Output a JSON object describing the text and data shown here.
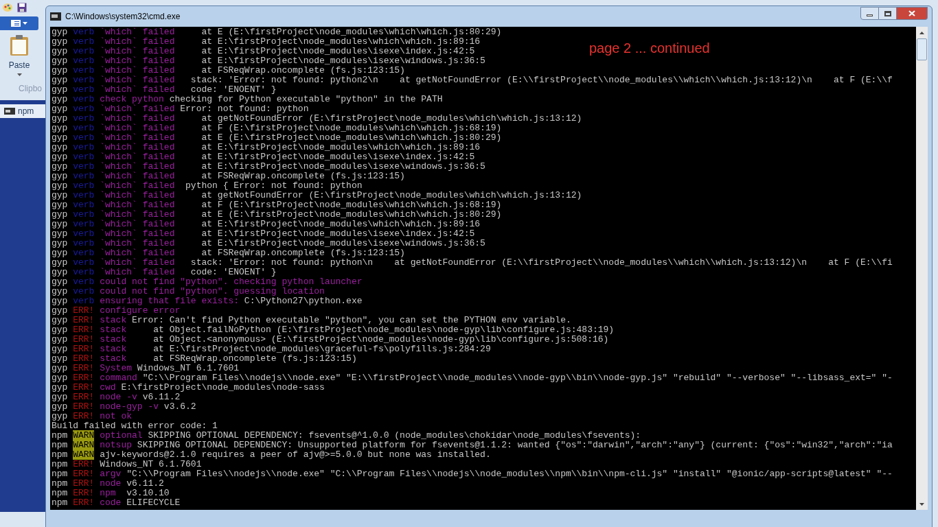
{
  "paint": {
    "paste_label": "Paste",
    "group_label": "Clipbo",
    "task_label": "npm"
  },
  "window": {
    "title": "C:\\Windows\\system32\\cmd.exe"
  },
  "annotation": "page 2 ... continued",
  "console": {
    "lines": [
      {
        "kind": "debug",
        "prefix": "gyp",
        "level": "verb",
        "tag": "`which` failed",
        "text": "    at E (E:\\firstProject\\node_modules\\which\\which.js:80:29)"
      },
      {
        "kind": "debug",
        "prefix": "gyp",
        "level": "verb",
        "tag": "`which` failed",
        "text": "    at E:\\firstProject\\node_modules\\which\\which.js:89:16"
      },
      {
        "kind": "debug",
        "prefix": "gyp",
        "level": "verb",
        "tag": "`which` failed",
        "text": "    at E:\\firstProject\\node_modules\\isexe\\index.js:42:5"
      },
      {
        "kind": "debug",
        "prefix": "gyp",
        "level": "verb",
        "tag": "`which` failed",
        "text": "    at E:\\firstProject\\node_modules\\isexe\\windows.js:36:5"
      },
      {
        "kind": "debug",
        "prefix": "gyp",
        "level": "verb",
        "tag": "`which` failed",
        "text": "    at FSReqWrap.oncomplete (fs.js:123:15)"
      },
      {
        "kind": "debug",
        "prefix": "gyp",
        "level": "verb",
        "tag": "`which` failed",
        "text": "  stack: 'Error: not found: python2\\n    at getNotFoundError (E:\\\\firstProject\\\\node_modules\\\\which\\\\which.js:13:12)\\n    at F (E:\\\\f"
      },
      {
        "kind": "debug",
        "prefix": "gyp",
        "level": "verb",
        "tag": "`which` failed",
        "text": "  code: 'ENOENT' }"
      },
      {
        "kind": "debug",
        "prefix": "gyp",
        "level": "verb",
        "tag": "check python",
        "text": "checking for Python executable \"python\" in the PATH"
      },
      {
        "kind": "debug",
        "prefix": "gyp",
        "level": "verb",
        "tag": "`which` failed",
        "text": "Error: not found: python"
      },
      {
        "kind": "debug",
        "prefix": "gyp",
        "level": "verb",
        "tag": "`which` failed",
        "text": "    at getNotFoundError (E:\\firstProject\\node_modules\\which\\which.js:13:12)"
      },
      {
        "kind": "debug",
        "prefix": "gyp",
        "level": "verb",
        "tag": "`which` failed",
        "text": "    at F (E:\\firstProject\\node_modules\\which\\which.js:68:19)"
      },
      {
        "kind": "debug",
        "prefix": "gyp",
        "level": "verb",
        "tag": "`which` failed",
        "text": "    at E (E:\\firstProject\\node_modules\\which\\which.js:80:29)"
      },
      {
        "kind": "debug",
        "prefix": "gyp",
        "level": "verb",
        "tag": "`which` failed",
        "text": "    at E:\\firstProject\\node_modules\\which\\which.js:89:16"
      },
      {
        "kind": "debug",
        "prefix": "gyp",
        "level": "verb",
        "tag": "`which` failed",
        "text": "    at E:\\firstProject\\node_modules\\isexe\\index.js:42:5"
      },
      {
        "kind": "debug",
        "prefix": "gyp",
        "level": "verb",
        "tag": "`which` failed",
        "text": "    at E:\\firstProject\\node_modules\\isexe\\windows.js:36:5"
      },
      {
        "kind": "debug",
        "prefix": "gyp",
        "level": "verb",
        "tag": "`which` failed",
        "text": "    at FSReqWrap.oncomplete (fs.js:123:15)"
      },
      {
        "kind": "debug",
        "prefix": "gyp",
        "level": "verb",
        "tag": "`which` failed",
        "text": " python { Error: not found: python"
      },
      {
        "kind": "debug",
        "prefix": "gyp",
        "level": "verb",
        "tag": "`which` failed",
        "text": "    at getNotFoundError (E:\\firstProject\\node_modules\\which\\which.js:13:12)"
      },
      {
        "kind": "debug",
        "prefix": "gyp",
        "level": "verb",
        "tag": "`which` failed",
        "text": "    at F (E:\\firstProject\\node_modules\\which\\which.js:68:19)"
      },
      {
        "kind": "debug",
        "prefix": "gyp",
        "level": "verb",
        "tag": "`which` failed",
        "text": "    at E (E:\\firstProject\\node_modules\\which\\which.js:80:29)"
      },
      {
        "kind": "debug",
        "prefix": "gyp",
        "level": "verb",
        "tag": "`which` failed",
        "text": "    at E:\\firstProject\\node_modules\\which\\which.js:89:16"
      },
      {
        "kind": "debug",
        "prefix": "gyp",
        "level": "verb",
        "tag": "`which` failed",
        "text": "    at E:\\firstProject\\node_modules\\isexe\\index.js:42:5"
      },
      {
        "kind": "debug",
        "prefix": "gyp",
        "level": "verb",
        "tag": "`which` failed",
        "text": "    at E:\\firstProject\\node_modules\\isexe\\windows.js:36:5"
      },
      {
        "kind": "debug",
        "prefix": "gyp",
        "level": "verb",
        "tag": "`which` failed",
        "text": "    at FSReqWrap.oncomplete (fs.js:123:15)"
      },
      {
        "kind": "debug",
        "prefix": "gyp",
        "level": "verb",
        "tag": "`which` failed",
        "text": "  stack: 'Error: not found: python\\n    at getNotFoundError (E:\\\\firstProject\\\\node_modules\\\\which\\\\which.js:13:12)\\n    at F (E:\\\\fi"
      },
      {
        "kind": "debug",
        "prefix": "gyp",
        "level": "verb",
        "tag": "`which` failed",
        "text": "  code: 'ENOENT' }"
      },
      {
        "kind": "debug",
        "prefix": "gyp",
        "level": "verb",
        "tag": "could not find \"python\". checking python launcher"
      },
      {
        "kind": "debug",
        "prefix": "gyp",
        "level": "verb",
        "tag": "could not find \"python\". guessing location"
      },
      {
        "kind": "debug",
        "prefix": "gyp",
        "level": "verb",
        "tag": "ensuring that file exists:",
        "text": "C:\\Python27\\python.exe"
      },
      {
        "kind": "error",
        "prefix": "gyp",
        "level": "ERR!",
        "tag": "configure error"
      },
      {
        "kind": "error",
        "prefix": "gyp",
        "level": "ERR!",
        "tag": "stack",
        "text": "Error: Can't find Python executable \"python\", you can set the PYTHON env variable."
      },
      {
        "kind": "error",
        "prefix": "gyp",
        "level": "ERR!",
        "tag": "stack",
        "text": "    at Object.failNoPython (E:\\firstProject\\node_modules\\node-gyp\\lib\\configure.js:483:19)"
      },
      {
        "kind": "error",
        "prefix": "gyp",
        "level": "ERR!",
        "tag": "stack",
        "text": "    at Object.<anonymous> (E:\\firstProject\\node_modules\\node-gyp\\lib\\configure.js:508:16)"
      },
      {
        "kind": "error",
        "prefix": "gyp",
        "level": "ERR!",
        "tag": "stack",
        "text": "    at E:\\firstProject\\node_modules\\graceful-fs\\polyfills.js:284:29"
      },
      {
        "kind": "error",
        "prefix": "gyp",
        "level": "ERR!",
        "tag": "stack",
        "text": "    at FSReqWrap.oncomplete (fs.js:123:15)"
      },
      {
        "kind": "error",
        "prefix": "gyp",
        "level": "ERR!",
        "tag": "System",
        "text": "Windows_NT 6.1.7601"
      },
      {
        "kind": "error",
        "prefix": "gyp",
        "level": "ERR!",
        "tag": "command",
        "text": "\"C:\\\\Program Files\\\\nodejs\\\\node.exe\" \"E:\\\\firstProject\\\\node_modules\\\\node-gyp\\\\bin\\\\node-gyp.js\" \"rebuild\" \"--verbose\" \"--libsass_ext=\" \"-"
      },
      {
        "kind": "error",
        "prefix": "gyp",
        "level": "ERR!",
        "tag": "cwd",
        "text": "E:\\firstProject\\node_modules\\node-sass"
      },
      {
        "kind": "error",
        "prefix": "gyp",
        "level": "ERR!",
        "tag": "node -v",
        "text": "v6.11.2"
      },
      {
        "kind": "error",
        "prefix": "gyp",
        "level": "ERR!",
        "tag": "node-gyp -v",
        "text": "v3.6.2"
      },
      {
        "kind": "error",
        "prefix": "gyp",
        "level": "ERR!",
        "tag": "not ok"
      },
      {
        "kind": "plain",
        "text": "Build failed with error code: 1"
      },
      {
        "kind": "warning",
        "prefix": "npm",
        "level": "WARN",
        "tag": "optional",
        "text": "SKIPPING OPTIONAL DEPENDENCY: fsevents@^1.0.0 (node_modules\\chokidar\\node_modules\\fsevents):"
      },
      {
        "kind": "warning",
        "prefix": "npm",
        "level": "WARN",
        "tag": "notsup",
        "text": "SKIPPING OPTIONAL DEPENDENCY: Unsupported platform for fsevents@1.1.2: wanted {\"os\":\"darwin\",\"arch\":\"any\"} (current: {\"os\":\"win32\",\"arch\":\"ia"
      },
      {
        "kind": "warning",
        "prefix": "npm",
        "level": "WARN",
        "text": "ajv-keywords@2.1.0 requires a peer of ajv@>=5.0.0 but none was installed."
      },
      {
        "kind": "error",
        "prefix": "npm",
        "level": "ERR!",
        "text": "Windows_NT 6.1.7601"
      },
      {
        "kind": "error",
        "prefix": "npm",
        "level": "ERR!",
        "tag": "argv",
        "text": "\"C:\\\\Program Files\\\\nodejs\\\\node.exe\" \"C:\\\\Program Files\\\\nodejs\\\\node_modules\\\\npm\\\\bin\\\\npm-cli.js\" \"install\" \"@ionic/app-scripts@latest\" \"--"
      },
      {
        "kind": "error",
        "prefix": "npm",
        "level": "ERR!",
        "tag": "node",
        "text": "v6.11.2"
      },
      {
        "kind": "error",
        "prefix": "npm",
        "level": "ERR!",
        "tag": "npm",
        "text": " v3.10.10"
      },
      {
        "kind": "error",
        "prefix": "npm",
        "level": "ERR!",
        "tag": "code",
        "text": "ELIFECYCLE"
      }
    ]
  }
}
